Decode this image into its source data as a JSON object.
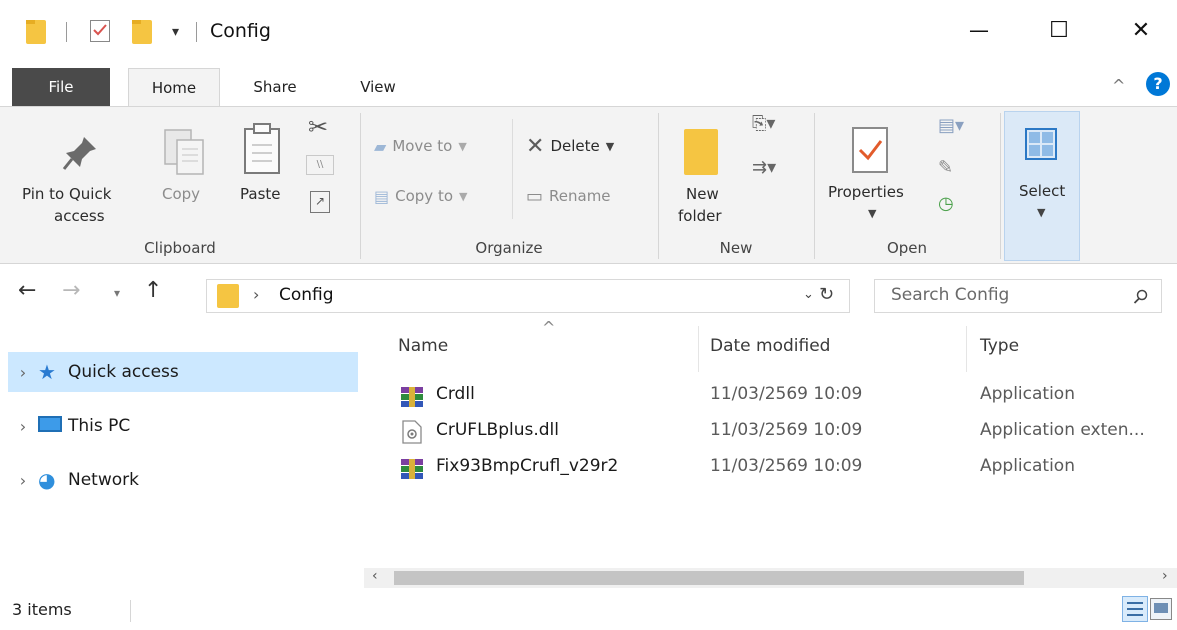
{
  "window": {
    "title": "Config",
    "minimize_label": "—",
    "maximize_label": "☐",
    "close_label": "✕"
  },
  "ribbon_tabs": {
    "file": "File",
    "home": "Home",
    "share": "Share",
    "view": "View"
  },
  "ribbon": {
    "clipboard": {
      "pin_line1": "Pin to Quick",
      "pin_line2": "access",
      "copy": "Copy",
      "paste": "Paste",
      "group": "Clipboard"
    },
    "organize": {
      "move_to": "Move to",
      "copy_to": "Copy to",
      "delete": "Delete",
      "rename": "Rename",
      "group": "Organize"
    },
    "new": {
      "folder_line1": "New",
      "folder_line2": "folder",
      "group": "New"
    },
    "open": {
      "properties": "Properties",
      "group": "Open"
    },
    "select": {
      "label": "Select"
    }
  },
  "address": {
    "path": "Config",
    "separator": "›",
    "search_placeholder": "Search Config"
  },
  "nav_pane": {
    "items": [
      {
        "label": "Quick access",
        "icon": "star-icon",
        "selected": true
      },
      {
        "label": "This PC",
        "icon": "computer-icon",
        "selected": false
      },
      {
        "label": "Network",
        "icon": "network-icon",
        "selected": false
      }
    ]
  },
  "file_list": {
    "columns": [
      "Name",
      "Date modified",
      "Type"
    ],
    "sort_indicator": "^",
    "rows": [
      {
        "name": "Crdll",
        "date": "11/03/2569 10:09",
        "type": "Application",
        "icon": "winrar-archive-icon"
      },
      {
        "name": "CrUFLBplus.dll",
        "date": "11/03/2569 10:09",
        "type": "Application exten...",
        "icon": "dll-file-icon"
      },
      {
        "name": "Fix93BmpCrufl_v29r2",
        "date": "11/03/2569 10:09",
        "type": "Application",
        "icon": "winrar-archive-icon"
      }
    ]
  },
  "status": {
    "item_count": "3 items"
  },
  "colors": {
    "accent": "#0078d7",
    "folder": "#f5c542",
    "selection": "#cce8ff",
    "file_tab": "#4a4a4a"
  }
}
